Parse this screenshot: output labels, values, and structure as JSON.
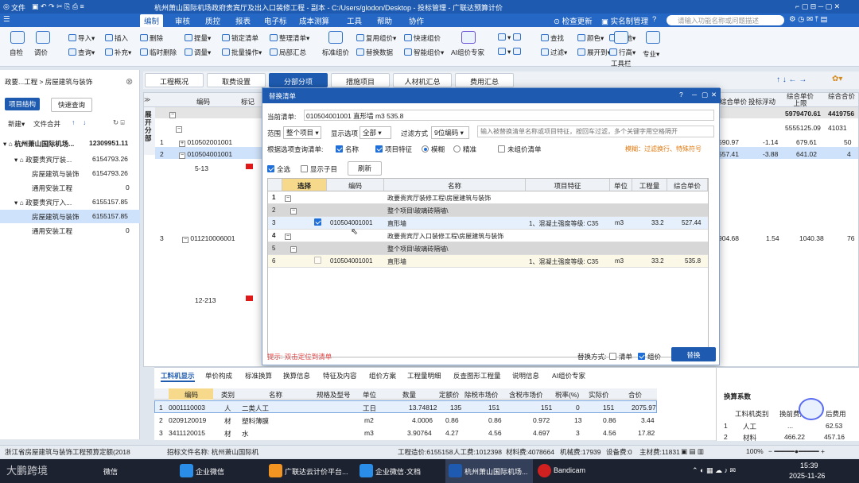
{
  "titlebar": {
    "file": "文件",
    "edit": "编制",
    "title": "杭州萧山国际机场政府贵宾厅及出入口装修工程 - 副本 - C:/Users/glodon/Desktop - 投标管理 - 广联达预算计价"
  },
  "menubar": {
    "items": [
      "编制",
      "审核",
      "质控",
      "报表",
      "电子标",
      "成本测算",
      "工具",
      "帮助",
      "协作"
    ],
    "check_update": "检查更新",
    "real_name": "实名制管理",
    "search_placeholder": "请输入功能名称或问题描述"
  },
  "ribbon": {
    "items": [
      "自检",
      "调价",
      "导入",
      "插入",
      "删除",
      "提量",
      "锁定清单",
      "整理清单",
      "查询",
      "补充",
      "临时删除",
      "调量",
      "批量操作",
      "局部汇总",
      "标准组价",
      "复用组价",
      "替换数据",
      "快速组价",
      "智能组价",
      "AI组价专家",
      "查找",
      "过滤",
      "颜色",
      "展开到",
      "其他",
      "行高",
      "工具栏",
      "专业"
    ]
  },
  "left": {
    "breadcrumb": "政要...工程 > 房屋建筑与装饰",
    "btn_structure": "项目结构",
    "btn_quick": "快速查询",
    "new": "新建",
    "merge": "文件合并",
    "tree": [
      {
        "label": "杭州萧山国际机场...",
        "value": "12309951.11"
      },
      {
        "label": "政要贵宾厅装...",
        "value": "6154793.26"
      },
      {
        "label": "房屋建筑与装饰",
        "value": "6154793.26"
      },
      {
        "label": "通用安装工程",
        "value": "0"
      },
      {
        "label": "政要贵宾厅入...",
        "value": "6155157.85"
      },
      {
        "label": "房屋建筑与装饰",
        "value": "6155157.85"
      },
      {
        "label": "通用安装工程",
        "value": "0"
      }
    ]
  },
  "tabs": [
    "工程概况",
    "取费设置",
    "分部分项",
    "措施项目",
    "人材机汇总",
    "费用汇总"
  ],
  "grid": {
    "headers": [
      "编码",
      "标记",
      "综合单价",
      "投标浮动",
      "综合单价上限",
      "综合合价"
    ],
    "side_label": "展开分部",
    "sum1": "5979470.61",
    "sum1b": "4419756",
    "sum2": "5555125.09",
    "sum2b": "41031",
    "rows": [
      {
        "no": "1",
        "code": "010502001001",
        "v1": "590.97",
        "v2": "-1.14",
        "v3": "679.61",
        "v4": "50"
      },
      {
        "no": "2",
        "code": "010504001001",
        "v1": "557.41",
        "v2": "-3.88",
        "v3": "641.02",
        "v4": "4"
      },
      {
        "no": "",
        "code": "5-13",
        "v1": "",
        "v2": "",
        "v3": "",
        "v4": ""
      },
      {
        "no": "3",
        "code": "011210006001",
        "v1": "904.68",
        "v2": "1.54",
        "v3": "1040.38",
        "v4": "76"
      },
      {
        "no": "",
        "code": "12-213",
        "v1": "",
        "v2": "",
        "v3": "",
        "v4": ""
      }
    ]
  },
  "dialog": {
    "title": "替换清单",
    "current_label": "当前清单:",
    "current_value": "010504001001 直形墙 m3 535.8",
    "scope_label": "范围",
    "scope_value": "整个项目",
    "show_label": "显示选项",
    "show_value": "全部",
    "filter_label": "过滤方式",
    "filter_value": "9位编码",
    "search_placeholder": "输入被替换清单名称或项目特征，按回车过滤，多个关键字用空格隔开",
    "cond_label": "根据选项查询清单:",
    "opt_name": "名称",
    "opt_feature": "项目特征",
    "opt_fuzzy": "模糊",
    "opt_exact": "精准",
    "opt_unpriced": "未组价清单",
    "hint_right": "模糊：过滤换行、特殊符号",
    "select_all": "全选",
    "show_sub": "显示子目",
    "refresh": "刷新",
    "headers": [
      "选择",
      "编码",
      "名称",
      "项目特征",
      "单位",
      "工程量",
      "综合单价"
    ],
    "rows": [
      {
        "no": "1",
        "code": "",
        "name": "政要贵宾厅装修工程\\房屋建筑与装饰",
        "feat": "",
        "unit": "",
        "qty": "",
        "price": ""
      },
      {
        "no": "2",
        "code": "",
        "name": "整个项目\\玻璃砖隔墙\\",
        "feat": "",
        "unit": "",
        "qty": "",
        "price": ""
      },
      {
        "no": "3",
        "code": "010504001001",
        "name": "直形墙",
        "feat": "1、混凝土强度等级: C35",
        "unit": "m3",
        "qty": "33.2",
        "price": "527.44"
      },
      {
        "no": "4",
        "code": "",
        "name": "政要贵宾厅入口装修工程\\房屋建筑与装饰",
        "feat": "",
        "unit": "",
        "qty": "",
        "price": ""
      },
      {
        "no": "5",
        "code": "",
        "name": "整个项目\\玻璃砖隔墙\\",
        "feat": "",
        "unit": "",
        "qty": "",
        "price": ""
      },
      {
        "no": "6",
        "code": "010504001001",
        "name": "直形墙",
        "feat": "1、混凝土强度等级: C35",
        "unit": "m3",
        "qty": "33.2",
        "price": "535.8"
      }
    ],
    "tip": "提示: 双击定位到清单",
    "replace_mode": "替换方式:",
    "mode_list": "清单",
    "mode_price": "组价",
    "replace_btn": "替换"
  },
  "bottom": {
    "tabs": [
      "工料机显示",
      "单价构成",
      "标准换算",
      "换算信息",
      "特征及内容",
      "组价方案",
      "工程量明细",
      "反查图形工程量",
      "说明信息",
      "AI组价专家"
    ],
    "headers": [
      "编码",
      "类别",
      "名称",
      "规格及型号",
      "单位",
      "数量",
      "定额价",
      "除税市场价",
      "含税市场价",
      "税率(%)",
      "实际价",
      "合价"
    ],
    "rows": [
      {
        "no": "1",
        "code": "0001110003",
        "type": "人",
        "name": "二类人工",
        "spec": "",
        "unit": "工日",
        "qty": "13.74812",
        "p1": "135",
        "p2": "151",
        "p3": "151",
        "tax": "0",
        "real": "151",
        "total": "2075.97"
      },
      {
        "no": "2",
        "code": "0209120019",
        "type": "材",
        "name": "塑料薄膜",
        "spec": "",
        "unit": "m2",
        "qty": "4.0006",
        "p1": "0.86",
        "p2": "0.86",
        "p3": "0.972",
        "tax": "13",
        "real": "0.86",
        "total": "3.44"
      },
      {
        "no": "3",
        "code": "3411120015",
        "type": "材",
        "name": "水",
        "spec": "",
        "unit": "m3",
        "qty": "3.90764",
        "p1": "4.27",
        "p2": "4.56",
        "p3": "4.697",
        "tax": "3",
        "real": "4.56",
        "total": "17.82"
      }
    ],
    "right_title": "换算系数",
    "right_headers": [
      "工料机类别",
      "换前费用",
      "后费用"
    ],
    "right_rows": [
      {
        "no": "1",
        "type": "人工",
        "a": "...",
        "b": "62.53"
      },
      {
        "no": "2",
        "type": "材料",
        "a": "466.22",
        "b": "457.16"
      }
    ]
  },
  "status": {
    "left": "浙江省房屋建筑与装饰工程预算定额(2018",
    "file": "招标文件名称: 杭州萧山国际机",
    "total": "工程造价:6155158",
    "labor": "人工费:1012398",
    "material": "材料费:4078664",
    "machine": "机械费:17939",
    "equip": "设备费:0",
    "main": "主材费:11831",
    "zoom": "100%"
  },
  "taskbar": {
    "items": [
      "微信",
      "企业微信",
      "广联达云计价平台...",
      "企业微信·文档",
      "杭州萧山国际机场...",
      "Bandicam"
    ],
    "time": "15:39",
    "date": "2025-11-26",
    "watermark": "大鹏跨境"
  }
}
